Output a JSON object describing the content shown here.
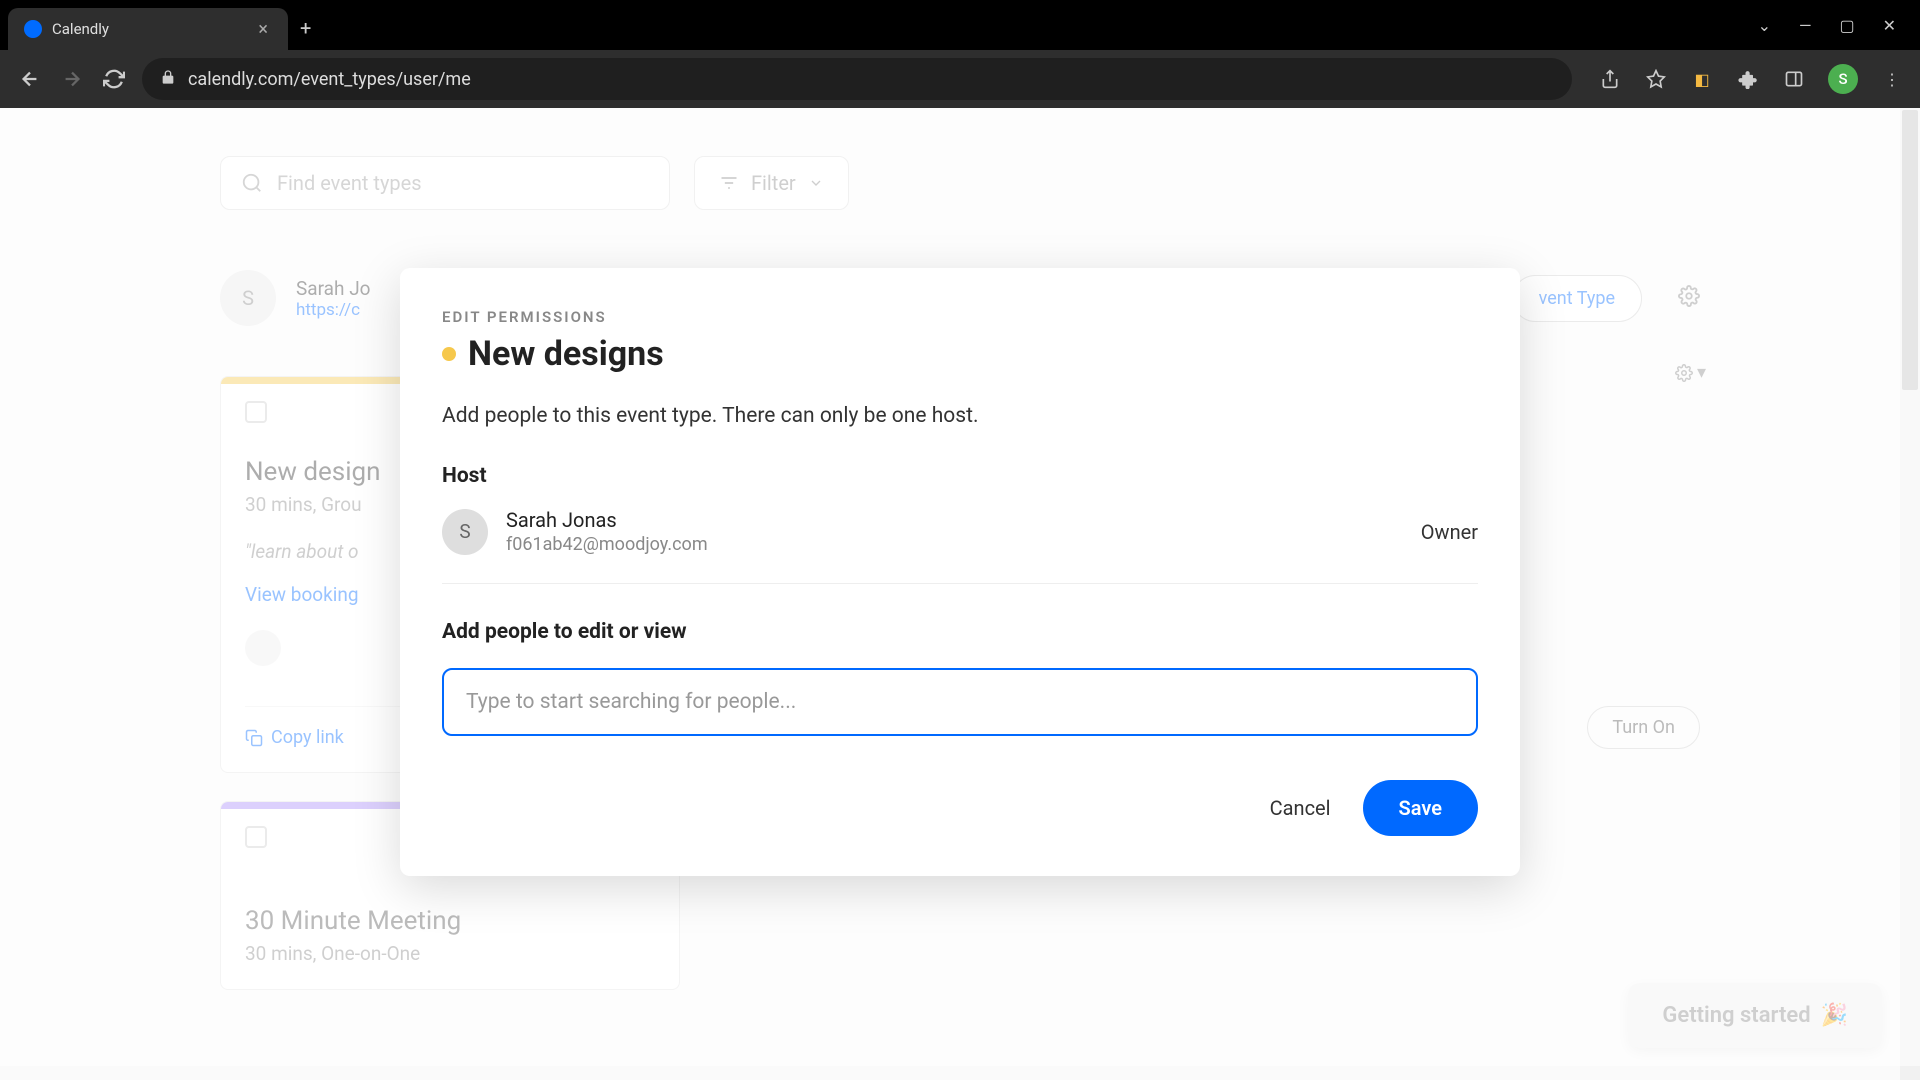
{
  "browser": {
    "tab_title": "Calendly",
    "url": "calendly.com/event_types/user/me",
    "avatar_letter": "S"
  },
  "page": {
    "search_placeholder": "Find event types",
    "filter_label": "Filter",
    "user": {
      "name": "Sarah Jo",
      "link": "https://c",
      "avatar": "S"
    },
    "new_event_btn": "vent Type",
    "cards": [
      {
        "title": "New design",
        "sub": "30 mins, Grou",
        "desc": "\"learn about o",
        "booking": "View booking",
        "copy": "Copy link",
        "turn_on": "Turn On"
      },
      {
        "title": "30 Minute Meeting",
        "sub": "30 mins, One-on-One"
      }
    ]
  },
  "modal": {
    "label": "EDIT PERMISSIONS",
    "title": "New designs",
    "description": "Add people to this event type. There can only be one host.",
    "host_label": "Host",
    "host": {
      "avatar": "S",
      "name": "Sarah Jonas",
      "email": "f061ab42@moodjoy.com",
      "role": "Owner"
    },
    "add_people_label": "Add people to edit or view",
    "input_placeholder": "Type to start searching for people...",
    "cancel": "Cancel",
    "save": "Save"
  },
  "getting_started": "Getting started"
}
